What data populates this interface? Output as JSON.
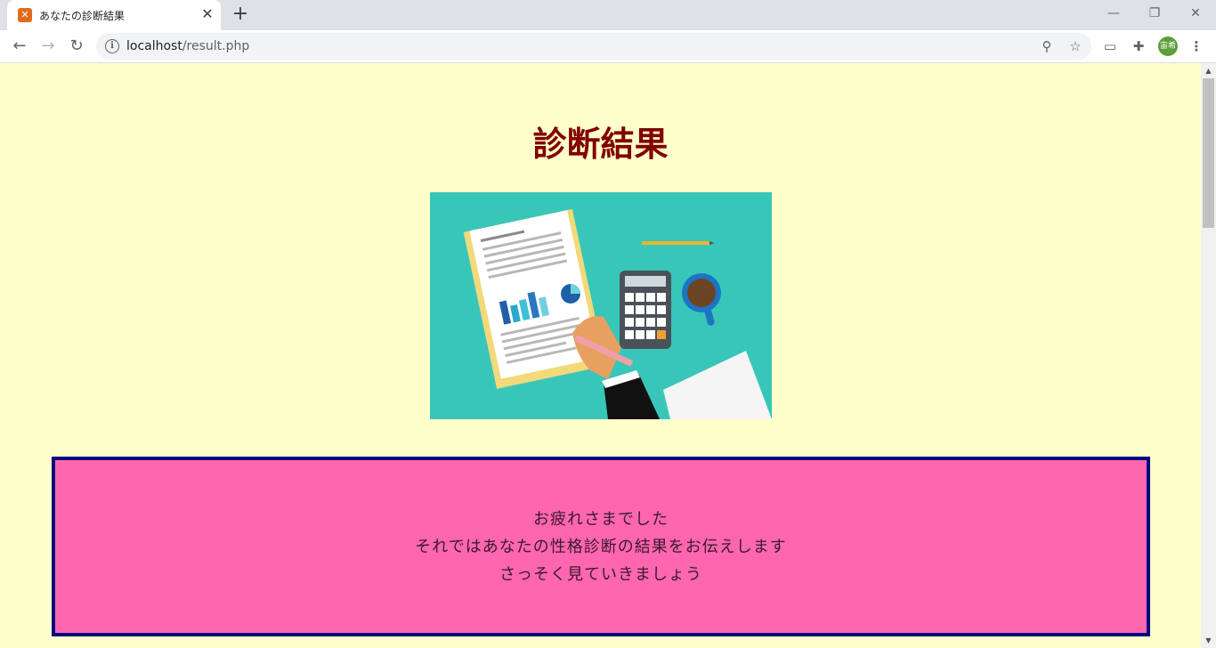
{
  "browser": {
    "tab_title": "あなたの診断結果",
    "url_host": "localhost",
    "url_path": "/result.php",
    "avatar_text": "宙希"
  },
  "page": {
    "title": "診断結果",
    "hero_image": "diagnosis-report-illustration",
    "messages": [
      "お疲れさまでした",
      "それではあなたの性格診断の結果をお伝えします",
      "さっそく見ていきましょう"
    ]
  },
  "colors": {
    "page_bg": "#ffffcc",
    "title": "#800000",
    "box_bg": "#ff66b0",
    "box_border": "#000080",
    "hero_bg": "#38c6b9"
  }
}
